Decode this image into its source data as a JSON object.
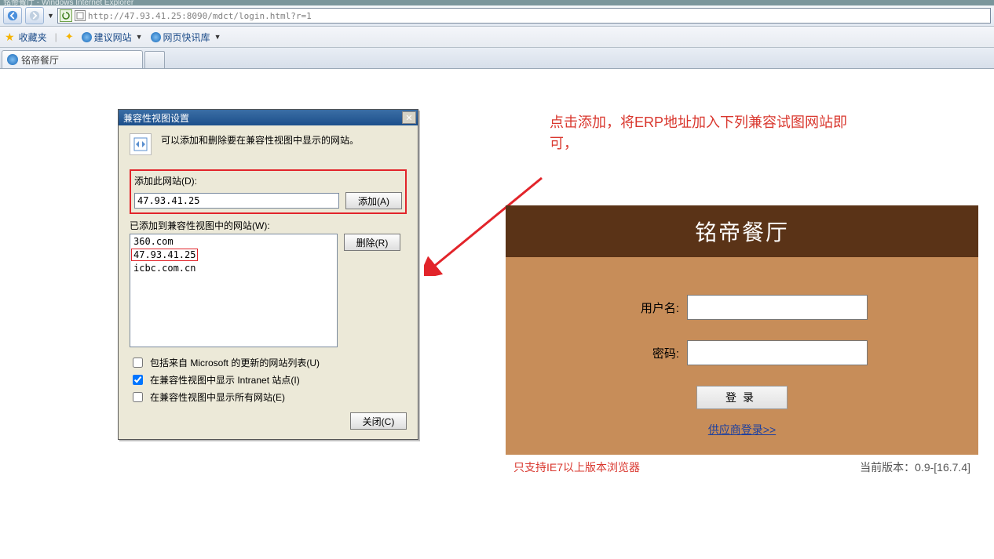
{
  "window": {
    "title": "铭帝餐厅 - Windows Internet Explorer"
  },
  "nav": {
    "url": "http://47.93.41.25:8090/mdct/login.html?r=1"
  },
  "favbar": {
    "label": "收藏夹",
    "items": [
      {
        "label": "建议网站"
      },
      {
        "label": "网页快讯库"
      }
    ]
  },
  "tab": {
    "label": "铭帝餐厅"
  },
  "dialog": {
    "title": "兼容性视图设置",
    "intro": "可以添加和删除要在兼容性视图中显示的网站。",
    "add_label": "添加此网站(D):",
    "add_value": "47.93.41.25",
    "add_btn": "添加(A)",
    "list_label": "已添加到兼容性视图中的网站(W):",
    "list": [
      "360.com",
      "47.93.41.25",
      "icbc.com.cn"
    ],
    "remove_btn": "删除(R)",
    "chk_ms": "包括来自 Microsoft 的更新的网站列表(U)",
    "chk_intranet": "在兼容性视图中显示 Intranet 站点(I)",
    "chk_all": "在兼容性视图中显示所有网站(E)",
    "close_btn": "关闭(C)"
  },
  "annotation": "点击添加，将ERP地址加入下列兼容试图网站即可，",
  "login": {
    "title": "铭帝餐厅",
    "user_label": "用户名:",
    "pass_label": "密码:",
    "login_btn": "登录",
    "supplier_link": "供应商登录>>",
    "warn": "只支持IE7以上版本浏览器",
    "version_label": "当前版本：",
    "version": "0.9-[16.7.4]"
  }
}
